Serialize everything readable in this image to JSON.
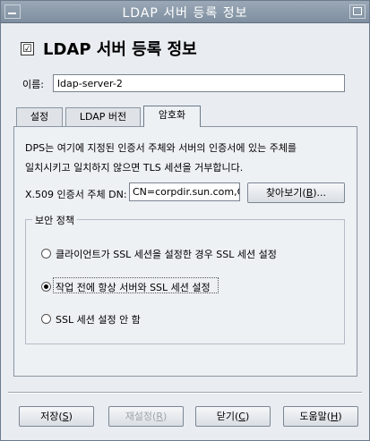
{
  "window": {
    "title": "LDAP 서버 등록 정보"
  },
  "header": {
    "checked": "☑",
    "title": "LDAP 서버 등록 정보"
  },
  "name_field": {
    "label": "이름:",
    "value": "ldap-server-2"
  },
  "tabs": [
    {
      "label": "설정"
    },
    {
      "label": "LDAP 버전"
    },
    {
      "label": "암호화"
    }
  ],
  "encryption": {
    "description_line1": "DPS는 여기에 지정된 인증서 주체와 서버의 인증서에 있는 주체를",
    "description_line2": "일치시키고 일치하지 않으면 TLS 세션을 거부합니다.",
    "dn_label": "X.509 인증서 주체 DN:",
    "dn_value": "CN=corpdir.sun.com,O=",
    "browse_label": "찾아보기(",
    "browse_key": "B",
    "browse_suffix": ")..."
  },
  "security_policy": {
    "title": "보안 정책",
    "options": [
      {
        "label": "클라이언트가 SSL 세션을 설정한 경우 SSL 세션 설정",
        "selected": false
      },
      {
        "label": "작업 전에 항상 서버와 SSL 세션 설정",
        "selected": true
      },
      {
        "label": "SSL 세션 설정 안 함",
        "selected": false
      }
    ]
  },
  "buttons": {
    "save": {
      "label": "저장(",
      "key": "S",
      "suffix": ")"
    },
    "reset": {
      "label": "재설정(",
      "key": "R",
      "suffix": ")"
    },
    "close": {
      "label": "닫기(",
      "key": "C",
      "suffix": ")"
    },
    "help": {
      "label": "도움말(",
      "key": "H",
      "suffix": ")"
    }
  }
}
